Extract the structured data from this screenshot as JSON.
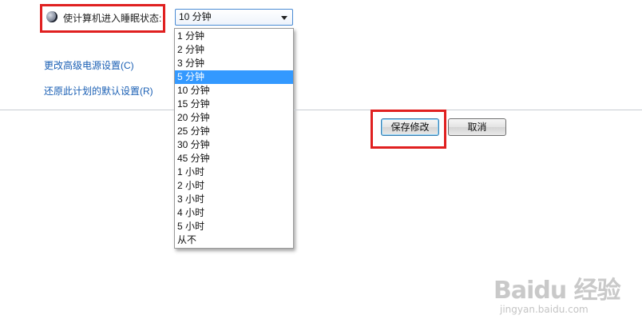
{
  "sleep_setting": {
    "label": "使计算机进入睡眠状态:",
    "selected_value": "10 分钟",
    "options": [
      "1 分钟",
      "2 分钟",
      "3 分钟",
      "5 分钟",
      "10 分钟",
      "15 分钟",
      "20 分钟",
      "25 分钟",
      "30 分钟",
      "45 分钟",
      "1 小时",
      "2 小时",
      "3 小时",
      "4 小时",
      "5 小时",
      "从不"
    ],
    "highlighted_option": "5 分钟"
  },
  "links": {
    "advanced_power": "更改高级电源设置(C)",
    "restore_defaults": "还原此计划的默认设置(R)"
  },
  "buttons": {
    "save": "保存修改",
    "cancel": "取消"
  },
  "watermark": {
    "logo": "Baidu 经验",
    "url": "jingyan.baidu.com"
  },
  "colors": {
    "annotation_red": "#e02020",
    "link_blue": "#1a5fb4",
    "highlight_blue": "#3399ff"
  }
}
